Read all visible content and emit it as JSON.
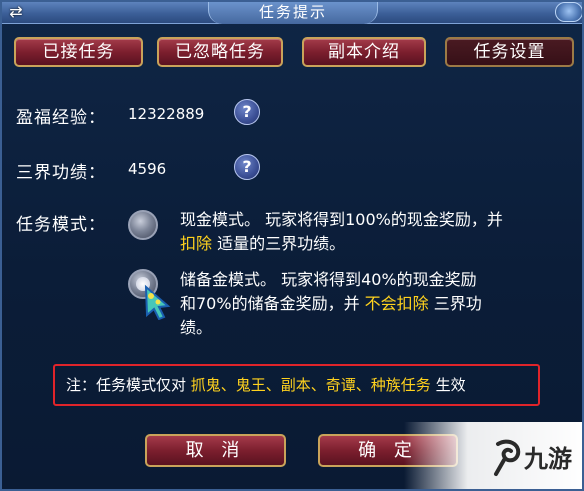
{
  "window": {
    "title": "任务提示",
    "swap_glyph": "⇄"
  },
  "tabs": [
    {
      "label": "已接任务",
      "active": false
    },
    {
      "label": "已忽略任务",
      "active": false
    },
    {
      "label": "副本介绍",
      "active": false
    },
    {
      "label": "任务设置",
      "active": true
    }
  ],
  "stats": {
    "fortune_exp_label": "盈福经验：",
    "fortune_exp_value": "12322889",
    "merit_label": "三界功绩：",
    "merit_value": "4596",
    "help_glyph": "?"
  },
  "mode": {
    "label": "任务模式：",
    "options": [
      {
        "selected": false,
        "line1_a": "现金模式。 玩家将得到100%的现金奖励，并",
        "line2_hl": "扣除",
        "line2_b": " 适量的三界功绩。"
      },
      {
        "selected": true,
        "line1": "储备金模式。 玩家将得到40%的现金奖励",
        "line2_a": "和70%的储备金奖励，并 ",
        "line2_hl": "不会扣除",
        "line2_b": " 三界功",
        "line3": "绩。"
      }
    ]
  },
  "note": {
    "prefix": "注：任务模式仅对 ",
    "highlight": "抓鬼、鬼王、副本、奇谭、种族任务",
    "suffix": " 生效"
  },
  "buttons": {
    "cancel": "取 消",
    "confirm": "确 定"
  },
  "watermark": {
    "text": "九游"
  },
  "colors": {
    "highlight": "#ffd21e",
    "note_border": "#e0242a",
    "button": "#7c1f2e"
  }
}
